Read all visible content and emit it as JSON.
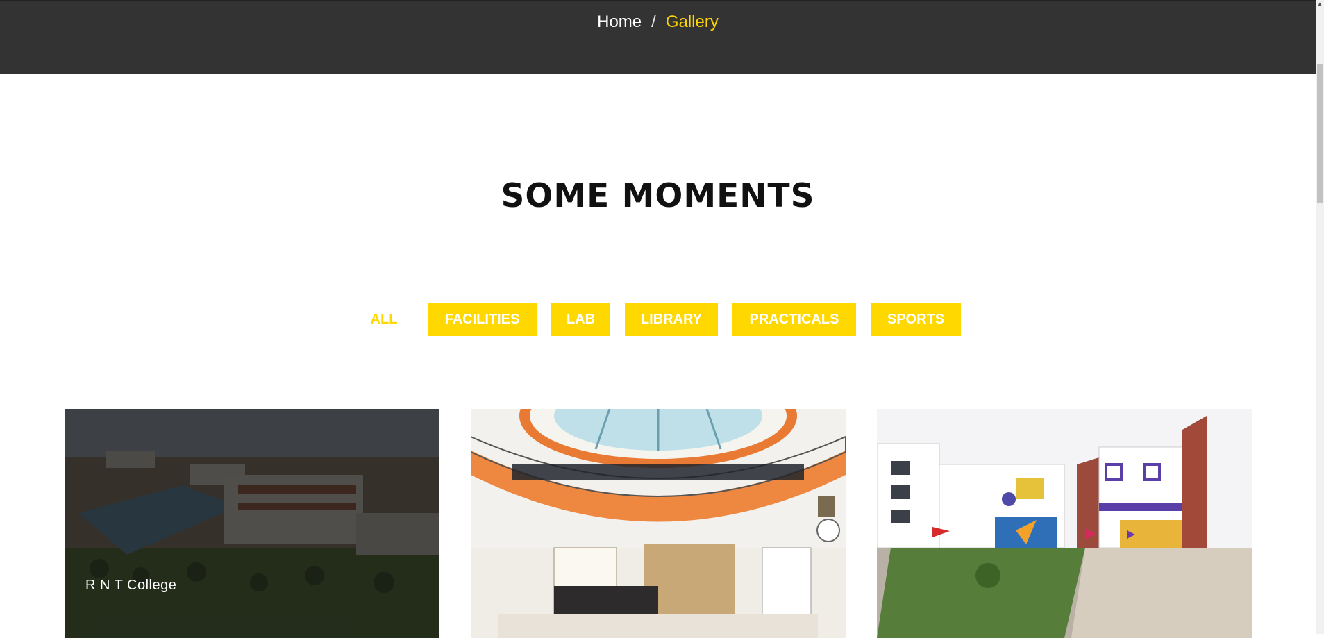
{
  "breadcrumb": {
    "home": "Home",
    "separator": "/",
    "current": "Gallery"
  },
  "section": {
    "title": "SOME MOMENTS"
  },
  "filters": [
    {
      "label": "ALL",
      "active": true
    },
    {
      "label": "FACILITIES",
      "active": false
    },
    {
      "label": "LAB",
      "active": false
    },
    {
      "label": "LIBRARY",
      "active": false
    },
    {
      "label": "PRACTICALS",
      "active": false
    },
    {
      "label": "SPORTS",
      "active": false
    }
  ],
  "gallery": [
    {
      "caption": "R N T College",
      "hovered": true
    },
    {
      "caption": "",
      "hovered": false
    },
    {
      "caption": "",
      "hovered": false
    }
  ],
  "colors": {
    "accent": "#ffd800",
    "header_bg": "#333333"
  }
}
